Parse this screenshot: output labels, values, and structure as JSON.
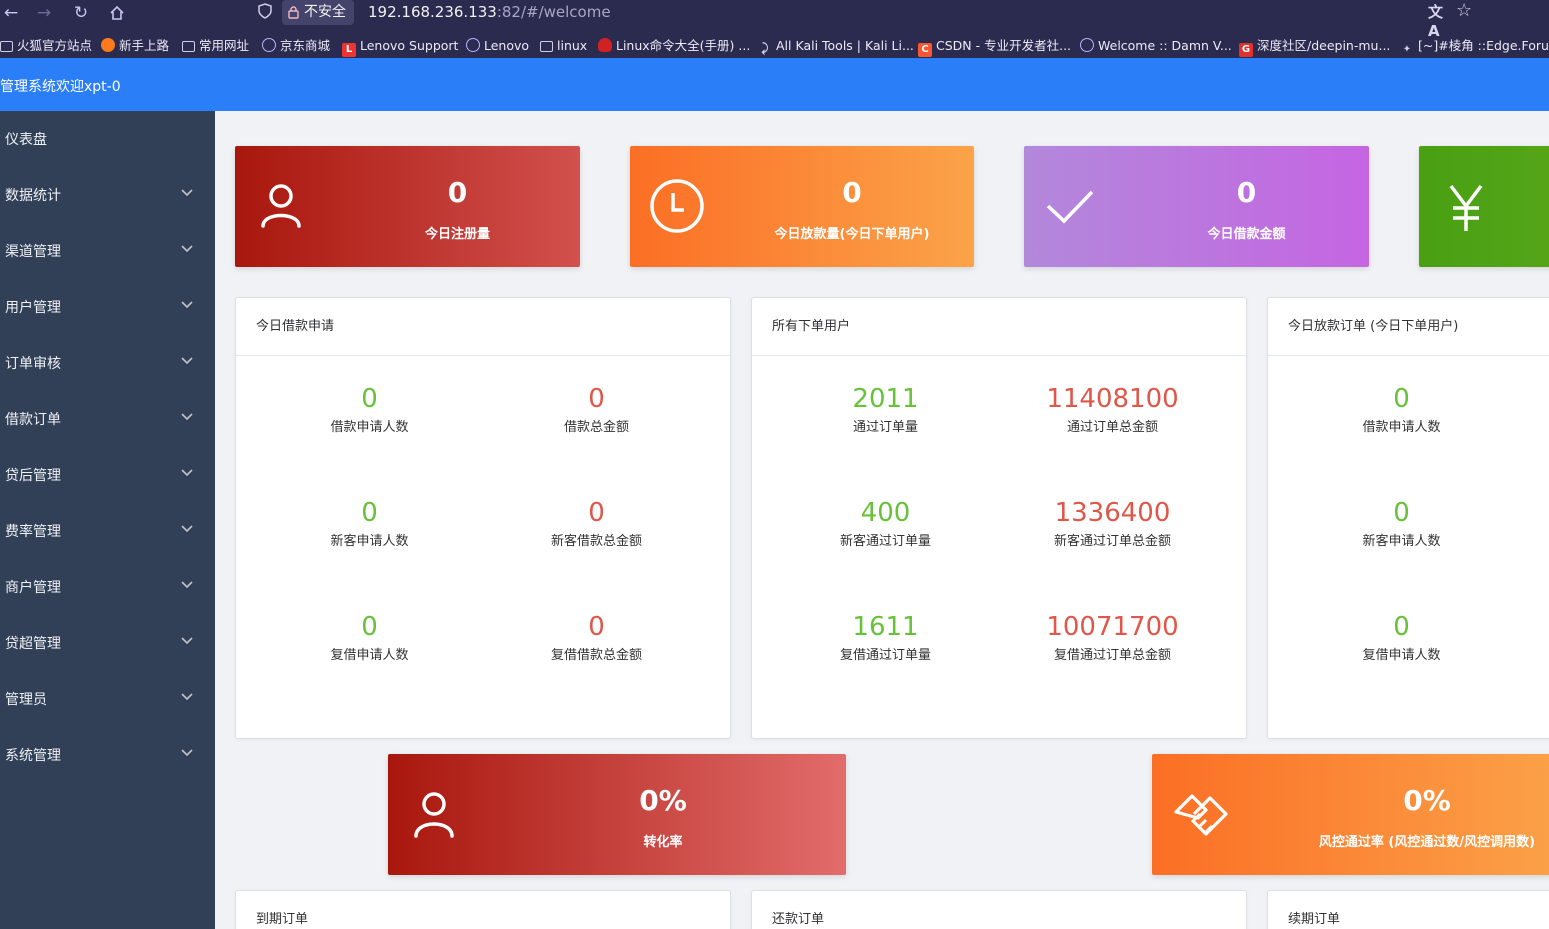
{
  "browser": {
    "insecure_label": "不安全",
    "url_host": "192.168.236.133",
    "url_rest": ":82/#/welcome",
    "bookmarks": [
      {
        "label": "火狐官方站点",
        "icon": "folder-icon"
      },
      {
        "label": "新手上路",
        "icon": "firefox-icon"
      },
      {
        "label": "常用网址",
        "icon": "folder-icon"
      },
      {
        "label": "京东商城",
        "icon": "globe-icon"
      },
      {
        "label": "Lenovo Support",
        "icon": "lenovo-icon"
      },
      {
        "label": "Lenovo",
        "icon": "globe-icon"
      },
      {
        "label": "linux",
        "icon": "folder-icon"
      },
      {
        "label": "Linux命令大全(手册) ...",
        "icon": "redhat-icon"
      },
      {
        "label": "All Kali Tools | Kali Li...",
        "icon": "kali-icon"
      },
      {
        "label": "CSDN - 专业开发者社...",
        "icon": "csdn-icon"
      },
      {
        "label": "Welcome :: Damn V...",
        "icon": "globe-icon"
      },
      {
        "label": "深度社区/deepin-mu...",
        "icon": "deepin-icon"
      },
      {
        "label": "[~]#棱角 ::Edge.Foru...",
        "icon": "edge-forum-icon"
      }
    ]
  },
  "header": {
    "title": "管理系统欢迎xpt-0",
    "accent": "#2a7ef7"
  },
  "sidebar": {
    "bg": "#324057",
    "items": [
      {
        "label": "仪表盘",
        "expandable": false
      },
      {
        "label": "数据统计",
        "expandable": true
      },
      {
        "label": "渠道管理",
        "expandable": true
      },
      {
        "label": "用户管理",
        "expandable": true
      },
      {
        "label": "订单审核",
        "expandable": true
      },
      {
        "label": "借款订单",
        "expandable": true
      },
      {
        "label": "贷后管理",
        "expandable": true
      },
      {
        "label": "费率管理",
        "expandable": true
      },
      {
        "label": "商户管理",
        "expandable": true
      },
      {
        "label": "贷超管理",
        "expandable": true
      },
      {
        "label": "管理员",
        "expandable": true
      },
      {
        "label": "系统管理",
        "expandable": true
      }
    ]
  },
  "stat_cards": [
    {
      "value": "0",
      "label": "今日注册量",
      "icon": "user-icon"
    },
    {
      "value": "0",
      "label": "今日放款量(今日下单用户)",
      "icon": "clock-icon"
    },
    {
      "value": "0",
      "label": "今日借款金额",
      "icon": "check-icon"
    },
    {
      "value": "",
      "label": "",
      "icon": "yen-icon"
    }
  ],
  "panels": [
    {
      "title": "今日借款申请",
      "cells": [
        {
          "value": "0",
          "label": "借款申请人数"
        },
        {
          "value": "0",
          "label": "借款总金额"
        },
        {
          "value": "0",
          "label": "新客申请人数"
        },
        {
          "value": "0",
          "label": "新客借款总金额"
        },
        {
          "value": "0",
          "label": "复借申请人数"
        },
        {
          "value": "0",
          "label": "复借借款总金额"
        }
      ]
    },
    {
      "title": "所有下单用户",
      "cells": [
        {
          "value": "2011",
          "label": "通过订单量"
        },
        {
          "value": "11408100",
          "label": "通过订单总金额"
        },
        {
          "value": "400",
          "label": "新客通过订单量"
        },
        {
          "value": "1336400",
          "label": "新客通过订单总金额"
        },
        {
          "value": "1611",
          "label": "复借通过订单量"
        },
        {
          "value": "10071700",
          "label": "复借通过订单总金额"
        }
      ]
    },
    {
      "title": "今日放款订单 (今日下单用户)",
      "cells": [
        {
          "value": "0",
          "label": "借款申请人数"
        },
        {
          "value": "0",
          "label": "新客申请人数"
        },
        {
          "value": "0",
          "label": "复借申请人数"
        }
      ]
    }
  ],
  "wide_cards": [
    {
      "value": "0%",
      "label": "转化率",
      "icon": "user-icon"
    },
    {
      "value": "0%",
      "label": "风控通过率 (风控通过数/风控调用数)",
      "icon": "handshake-icon"
    }
  ],
  "bottom_panels": [
    {
      "title": "到期订单"
    },
    {
      "title": "还款订单"
    },
    {
      "title": "续期订单"
    }
  ]
}
